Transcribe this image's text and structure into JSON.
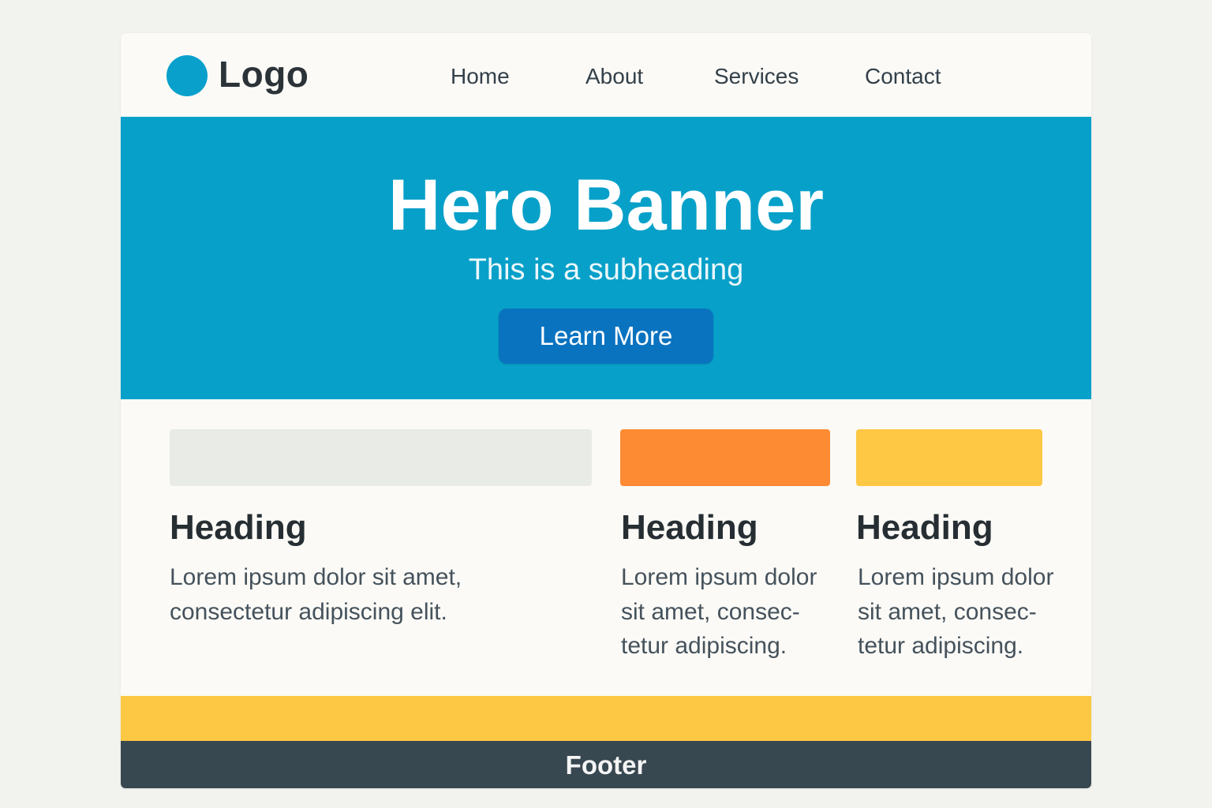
{
  "header": {
    "logo_label": "Logo",
    "nav": [
      {
        "label": "Home"
      },
      {
        "label": "About"
      },
      {
        "label": "Services"
      },
      {
        "label": "Contact"
      }
    ]
  },
  "hero": {
    "title": "Hero Banner",
    "subtitle": "This is a subheading",
    "button_label": "Learn More"
  },
  "cards": [
    {
      "heading": "Heading",
      "body_lines": [
        "Lorem ipsum dolor sit amet,",
        "consectetur adipiscing elit."
      ],
      "accent_color": "#e9ebe6"
    },
    {
      "heading": "Heading",
      "body_lines": [
        "Lorem ipsum dolor",
        "sit amet, consec-",
        "tetur adipiscing."
      ],
      "accent_color": "#fd8b33"
    },
    {
      "heading": "Heading",
      "body_lines": [
        "Lorem ipsum dolor",
        "sit amet, consec-",
        "tetur adipiscing."
      ],
      "accent_color": "#fec844"
    }
  ],
  "footer": {
    "label": "Footer"
  },
  "colors": {
    "hero_background": "#07a0c9",
    "button_background": "#0a73c0",
    "logo_mark": "#09a0cc",
    "footer_stripe": "#fdc843",
    "footer_background": "#384851"
  },
  "icons": {
    "logo": "circle-logo-icon"
  }
}
